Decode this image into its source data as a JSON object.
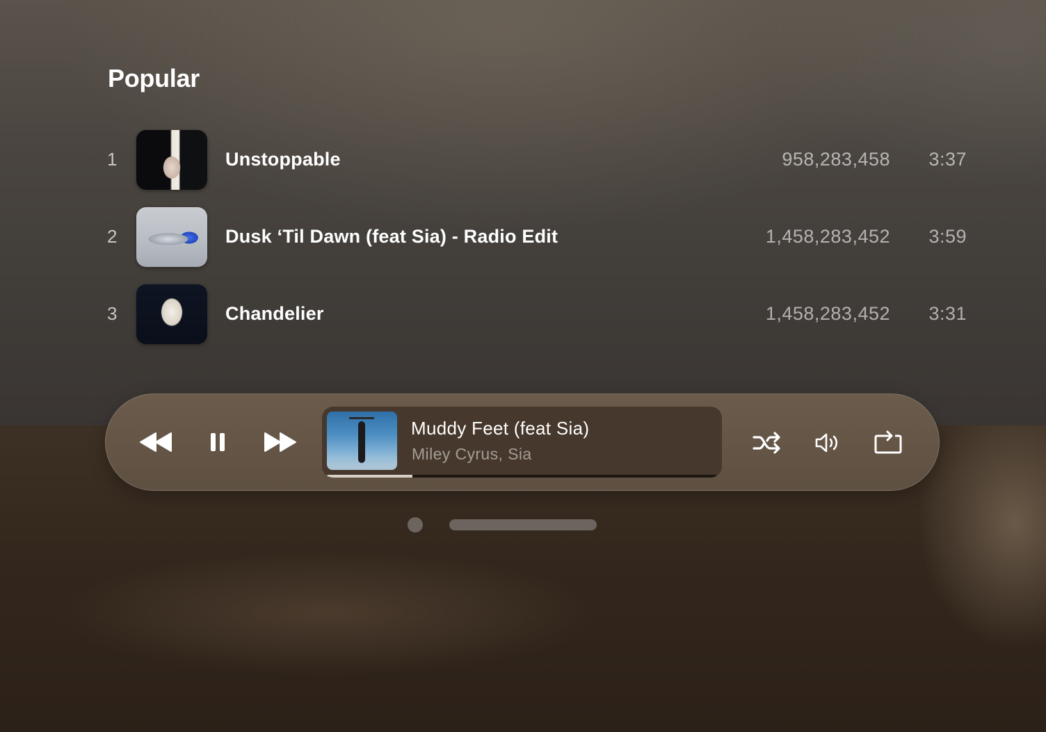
{
  "section": {
    "title": "Popular"
  },
  "tracks": [
    {
      "number": "1",
      "title": "Unstoppable",
      "plays": "958,283,458",
      "duration": "3:37"
    },
    {
      "number": "2",
      "title": "Dusk ‘Til Dawn (feat Sia) - Radio Edit",
      "plays": "1,458,283,452",
      "duration": "3:59"
    },
    {
      "number": "3",
      "title": "Chandelier",
      "plays": "1,458,283,452",
      "duration": "3:31"
    }
  ],
  "player": {
    "controls": {
      "rewind_icon": "rewind-icon",
      "pause_icon": "pause-icon",
      "forward_icon": "fast-forward-icon",
      "shuffle_icon": "shuffle-icon",
      "volume_icon": "volume-icon",
      "repeat_icon": "repeat-icon"
    },
    "now_playing": {
      "title": "Muddy Feet (feat Sia)",
      "artist": "Miley Cyrus, Sia",
      "progress": 0.22
    }
  },
  "colors": {
    "text_primary": "#ffffff",
    "player_bg": "#6e5e4e",
    "now_playing_bg": "#46382c",
    "progress_fill": "#d8d0c6"
  }
}
